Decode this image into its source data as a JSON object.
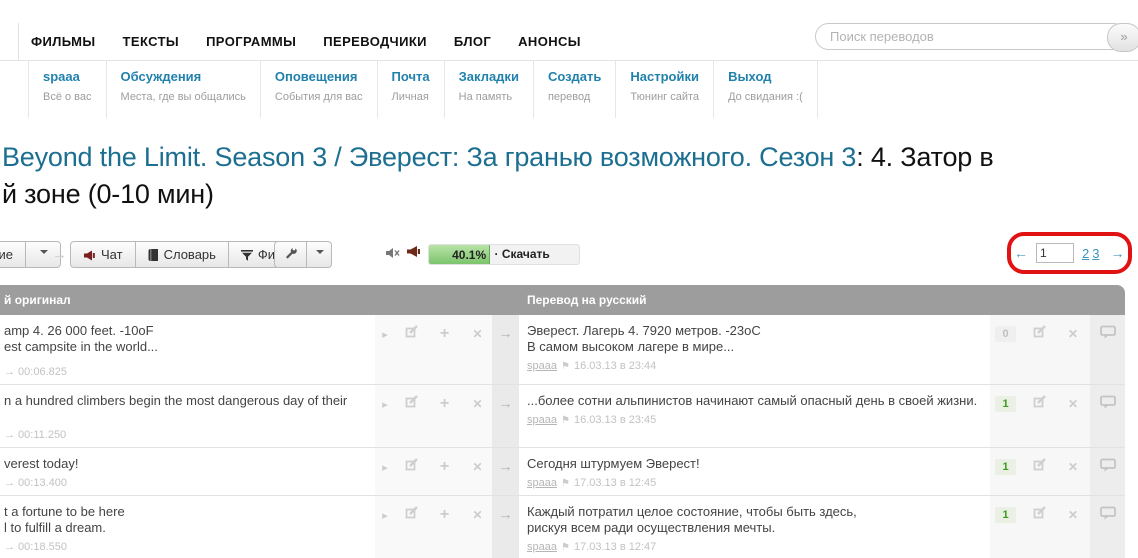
{
  "nav": {
    "items": [
      "ФИЛЬМЫ",
      "ТЕКСТЫ",
      "ПРОГРАММЫ",
      "ПЕРЕВОДЧИКИ",
      "БЛОГ",
      "АНОНСЫ"
    ]
  },
  "search": {
    "placeholder": "Поиск переводов",
    "button": "»"
  },
  "user_nav": {
    "items": [
      {
        "title": "spaaa",
        "subtitle": "Всё о вас"
      },
      {
        "title": "Обсуждения",
        "subtitle": "Места, где вы общались"
      },
      {
        "title": "Оповещения",
        "subtitle": "События для вас"
      },
      {
        "title": "Почта",
        "subtitle": "Личная"
      },
      {
        "title": "Закладки",
        "subtitle": "На память"
      },
      {
        "title": "Создать",
        "subtitle": "перевод"
      },
      {
        "title": "Настройки",
        "subtitle": "Тюнинг сайта"
      },
      {
        "title": "Выход",
        "subtitle": "До свидания :("
      }
    ]
  },
  "title": {
    "link": "Beyond the Limit. Season 3 / Эверест: За гранью возможного. Сезон 3",
    "suffix": ": 4. Затор в",
    "line2": "й зоне (0-10 мин)"
  },
  "toolbar": {
    "truncated_button": "ние",
    "chat": "Чат",
    "dictionary": "Словарь",
    "filter": "Фильтр",
    "progress": {
      "percent": "40.1%",
      "label": "· Скачать",
      "value": 40.1
    }
  },
  "pagination": {
    "prev": "←",
    "current": "1",
    "pages": [
      "2",
      "3"
    ],
    "next": "→"
  },
  "annotation_color": "#e01212",
  "table": {
    "headers": {
      "original": "й оригинал",
      "translation": "Перевод на русский"
    },
    "rows": [
      {
        "original_lines": [
          "amp 4. 26 000 feet. -10oF",
          "est campsite in the world..."
        ],
        "timecode": "→ 00:06.825",
        "translation_lines": [
          "Эверест. Лагерь 4. 7920 метров. -23оС",
          "В самом высоком лагере в мире..."
        ],
        "author": "spaaa",
        "date": "16.03.13 в 23:44",
        "rating": "0",
        "rating_positive": false
      },
      {
        "original_lines": [
          "n a hundred climbers begin the most dangerous day of their"
        ],
        "timecode": "→ 00:11.250",
        "translation_lines": [
          "...более сотни альпинистов начинают самый опасный день в своей жизни."
        ],
        "author": "spaaa",
        "date": "16.03.13 в 23:45",
        "rating": "1",
        "rating_positive": true
      },
      {
        "original_lines": [
          "verest today!"
        ],
        "timecode": "→ 00:13.400",
        "translation_lines": [
          "Сегодня штурмуем Эверест!"
        ],
        "author": "spaaa",
        "date": "17.03.13 в 12:45",
        "rating": "1",
        "rating_positive": true
      },
      {
        "original_lines": [
          "t a fortune to be here",
          "l to fulfill a dream."
        ],
        "timecode": "→ 00:18.550",
        "translation_lines": [
          "Каждый потратил целое состояние, чтобы быть здесь,",
          "рискуя всем ради осуществления мечты."
        ],
        "author": "spaaa",
        "date": "17.03.13 в 12:47",
        "rating": "1",
        "rating_positive": true
      }
    ]
  },
  "icons": {
    "search_button": "double-angle-icon",
    "chat": "megaphone-icon",
    "dictionary": "book-icon",
    "filter": "funnel-icon",
    "tools": "wrench-icon",
    "mute": "speaker-off-icon",
    "announce": "megaphone-icon",
    "row": [
      "play-icon",
      "edit-icon",
      "add-icon",
      "delete-icon",
      "transfer-arrow-icon",
      "flag-icon",
      "comment-icon"
    ]
  }
}
